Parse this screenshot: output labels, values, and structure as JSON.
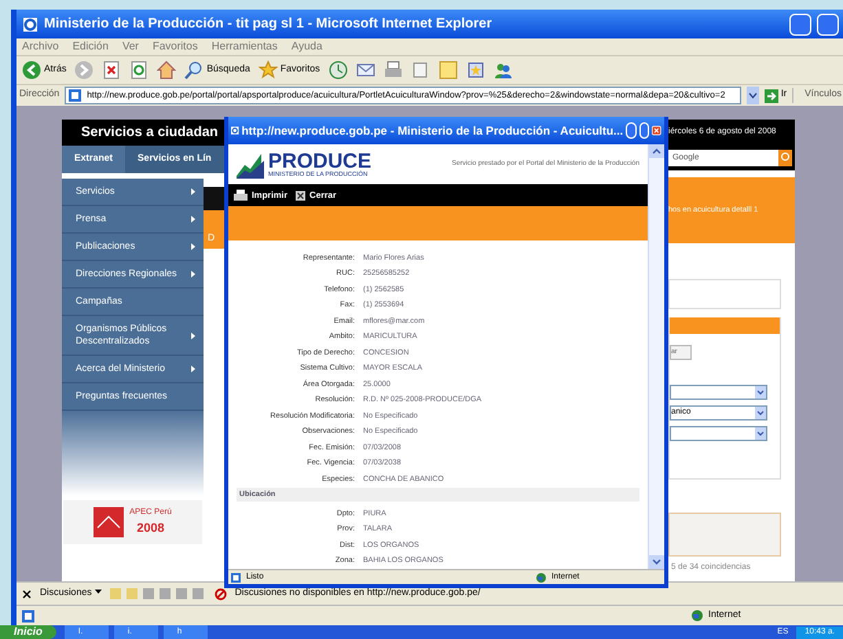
{
  "browser": {
    "title": "Ministerio de la Producción - tit pag sl 1 - Microsoft Internet Explorer",
    "menu": [
      "Archivo",
      "Edición",
      "Ver",
      "Favoritos",
      "Herramientas",
      "Ayuda"
    ],
    "toolbar": [
      {
        "kind": "back",
        "label": "Atrás"
      },
      {
        "kind": "forward"
      },
      {
        "kind": "stop"
      },
      {
        "kind": "refresh"
      },
      {
        "kind": "home"
      },
      {
        "kind": "search",
        "label": "Búsqueda"
      },
      {
        "kind": "favorites",
        "label": "Favoritos"
      },
      {
        "kind": "history"
      },
      {
        "kind": "mail"
      },
      {
        "kind": "print"
      },
      {
        "kind": "edit"
      },
      {
        "kind": "note"
      },
      {
        "kind": "messenger"
      },
      {
        "kind": "people"
      }
    ],
    "address_label": "Dirección",
    "url": "http://new.produce.gob.pe/portal/portal/apsportalproduce/acuicultura/PortletAcuiculturaWindow?prov=%25&derecho=2&windowstate=normal&depa=20&cultivo=2",
    "go": "Ir",
    "links": "Vínculos"
  },
  "page": {
    "header": "Servicios a ciudadan",
    "date": "iércoles 6 de agosto del 2008",
    "tabs": [
      {
        "label": "Extranet",
        "selected": true
      },
      {
        "label": "Servicios en Lín",
        "selected": false
      }
    ],
    "search_placeholder": "Google",
    "sidebar": [
      {
        "label": "Servicios",
        "submenu": true
      },
      {
        "label": "Prensa",
        "submenu": true
      },
      {
        "label": "Publicaciones",
        "submenu": true
      },
      {
        "label": "Direcciones Regionales",
        "submenu": true
      },
      {
        "label": "Campañas",
        "submenu": false
      },
      {
        "label": "Organismos Públicos Descentralizados",
        "submenu": true
      },
      {
        "label": "Acerca del Ministerio",
        "submenu": true
      },
      {
        "label": "Preguntas frecuentes",
        "submenu": false
      }
    ],
    "banner": {
      "title": "APEC Perú",
      "year": "2008"
    },
    "partial_letter": "D",
    "orange_text": "hos en acuicultura detalll 1",
    "button": "ar",
    "dropdowns": [
      {
        "kind": "empty"
      },
      {
        "kind": "filled",
        "value": "anico"
      },
      {
        "kind": "empty"
      }
    ],
    "results": "5 de 34 coincidencias"
  },
  "popup": {
    "title": "http://new.produce.gob.pe - Ministerio de la Producción - Acuicultu...",
    "logo": "PRODUCE",
    "logo_sub": "MINISTERIO DE LA PRODUCCIÓN",
    "note": "Servicio prestado por el Portal del Ministerio de la Producción",
    "actions": [
      {
        "kind": "print",
        "label": "Imprimir"
      },
      {
        "kind": "close",
        "label": "Cerrar"
      }
    ],
    "fields": [
      {
        "label": "Representante:",
        "value": "Mario Flores Arias"
      },
      {
        "label": "RUC:",
        "value": "25256585252"
      },
      {
        "label": "Telefono:",
        "value": "(1)  2562585"
      },
      {
        "label": "Fax:",
        "value": "(1)  2553694"
      },
      {
        "label": "Email:",
        "value": "mflores@mar.com"
      },
      {
        "label": "Ambito:",
        "value": "MARICULTURA"
      },
      {
        "label": "Tipo de Derecho:",
        "value": "CONCESION"
      },
      {
        "label": "Sistema Cultivo:",
        "value": "MAYOR ESCALA"
      },
      {
        "label": "Área Otorgada:",
        "value": "25.0000"
      },
      {
        "label": "Resolución:",
        "value": "R.D. Nº 025-2008-PRODUCE/DGA"
      },
      {
        "label": "Resolución Modificatoria:",
        "value": "No Especificado"
      },
      {
        "label": "Observaciones:",
        "value": "No Especificado"
      },
      {
        "label": "Fec. Emisión:",
        "value": "07/03/2008"
      },
      {
        "label": "Fec. Vigencia:",
        "value": "07/03/2038"
      },
      {
        "label": "Especies:",
        "value": "CONCHA DE ABANICO"
      }
    ],
    "section": "Ubicación",
    "location": [
      {
        "label": "Dpto:",
        "value": "PIURA"
      },
      {
        "label": "Prov:",
        "value": "TALARA"
      },
      {
        "label": "Dist:",
        "value": "LOS ORGANOS"
      },
      {
        "label": "Zona:",
        "value": "BAHIA LOS ORGANOS"
      }
    ],
    "status": "Listo",
    "zone": "Internet"
  },
  "discussions": {
    "label": "Discusiones",
    "message": "Discusiones no disponibles en http://new.produce.gob.pe/"
  },
  "status_zone": "Internet",
  "taskbar": {
    "start": "Inicio",
    "tasks": [
      "I.",
      "i.",
      "h"
    ],
    "lang": "ES",
    "clock": "10:43 a."
  }
}
